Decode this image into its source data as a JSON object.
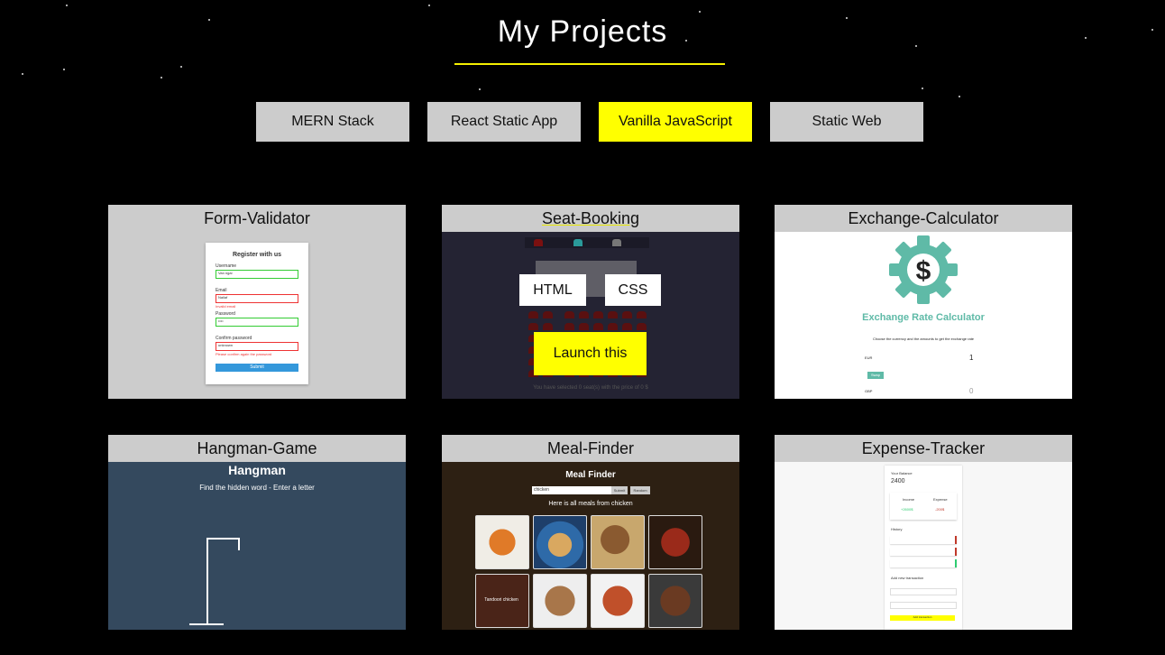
{
  "page": {
    "title": "My Projects"
  },
  "filters": [
    {
      "label": "MERN Stack",
      "active": false
    },
    {
      "label": "React Static App",
      "active": false
    },
    {
      "label": "Vanilla JavaScript",
      "active": true
    },
    {
      "label": "Static Web",
      "active": false
    }
  ],
  "projects": {
    "form_validator": {
      "title": "Form-Validator",
      "preview": {
        "heading": "Register with us",
        "username_label": "Username",
        "username_value": "Van ngai",
        "email_label": "Email",
        "email_value": "Nailaf",
        "email_error": "Invalid email",
        "password_label": "Password",
        "password_value": "••••",
        "confirm_label": "Confirm password",
        "confirm_value": "unknown",
        "confirm_error": "Please confirm again the password",
        "submit": "Submit"
      }
    },
    "seat_booking": {
      "title": "Seat-Booking",
      "html_button": "HTML",
      "css_button": "CSS",
      "launch_button": "Launch this",
      "preview": {
        "info": "You have selected 0 seat(s) with the price of 0 $"
      }
    },
    "exchange_calculator": {
      "title": "Exchange-Calculator",
      "preview": {
        "heading": "Exchange Rate Calculator",
        "subtitle": "Choose the currency and the amounts to get the exchange rate",
        "swap": "Swap",
        "from_currency": "EUR",
        "to_currency": "GBP",
        "amount_one": "1",
        "amount_two": "0"
      }
    },
    "hangman_game": {
      "title": "Hangman-Game",
      "preview": {
        "heading": "Hangman",
        "subtitle": "Find the hidden word - Enter a letter"
      }
    },
    "meal_finder": {
      "title": "Meal-Finder",
      "preview": {
        "heading": "Meal Finder",
        "search_value": "chicken",
        "submit": "Submit",
        "random": "Random",
        "results_text": "Here is all meals from chicken",
        "hover_label": "Tandoori chicken"
      }
    },
    "expense_tracker": {
      "title": "Expense-Tracker",
      "preview": {
        "balance_label": "Your Balance",
        "balance_value": "2400",
        "income_label": "Income",
        "income_value": "+2600$",
        "expense_label": "Expense",
        "expense_value": "-200$",
        "history_label": "History",
        "add_label": "Add new transaction",
        "add_button": "Add transaction"
      }
    }
  }
}
